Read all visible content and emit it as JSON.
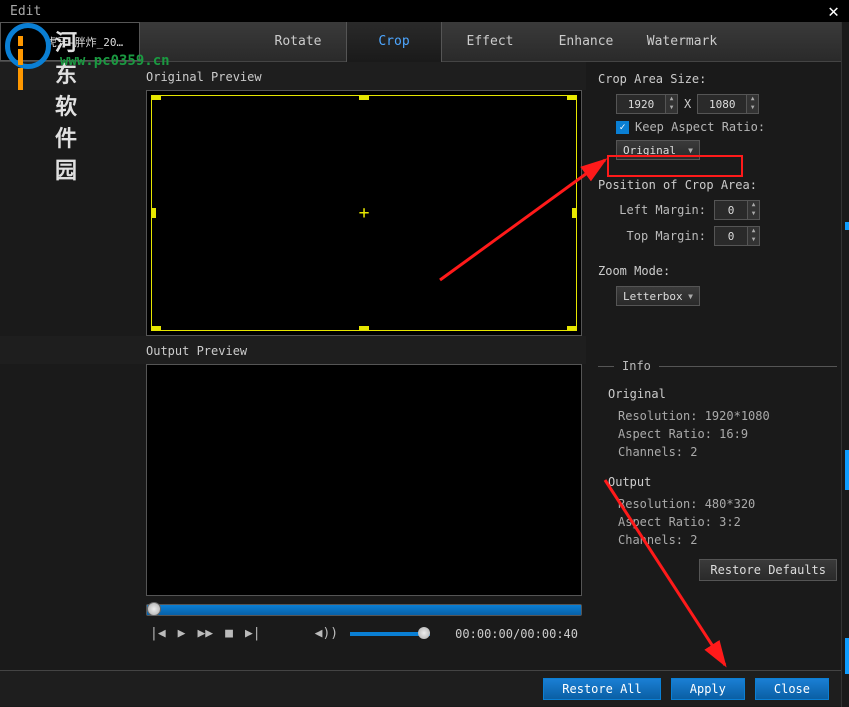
{
  "window": {
    "title": "Edit"
  },
  "thumb": {
    "name": "虎牙-胖炸_20…"
  },
  "logo": {
    "text1": "河东软件园",
    "text2": "www.pc0359.cn"
  },
  "tabs": {
    "rotate": "Rotate",
    "crop": "Crop",
    "effect": "Effect",
    "enhance": "Enhance",
    "watermark": "Watermark"
  },
  "preview": {
    "original_label": "Original Preview",
    "output_label": "Output Preview"
  },
  "player": {
    "time": "00:00:00/00:00:40"
  },
  "crop": {
    "size_label": "Crop Area Size:",
    "width": "1920",
    "height": "1080",
    "x": "X",
    "keep_ratio_label": "Keep Aspect Ratio:",
    "ratio_select": "Original"
  },
  "position": {
    "label": "Position of Crop Area:",
    "left_margin_label": "Left Margin:",
    "left_margin": "0",
    "top_margin_label": "Top Margin:",
    "top_margin": "0"
  },
  "zoom": {
    "label": "Zoom Mode:",
    "value": "Letterbox"
  },
  "info": {
    "title": "Info",
    "original": {
      "head": "Original",
      "resolution": "Resolution: 1920*1080",
      "aspect": "Aspect Ratio: 16:9",
      "channels": "Channels: 2"
    },
    "output": {
      "head": "Output",
      "resolution": "Resolution: 480*320",
      "aspect": "Aspect Ratio: 3:2",
      "channels": "Channels: 2"
    }
  },
  "buttons": {
    "restore_defaults": "Restore Defaults",
    "restore_all": "Restore All",
    "apply": "Apply",
    "close": "Close"
  }
}
